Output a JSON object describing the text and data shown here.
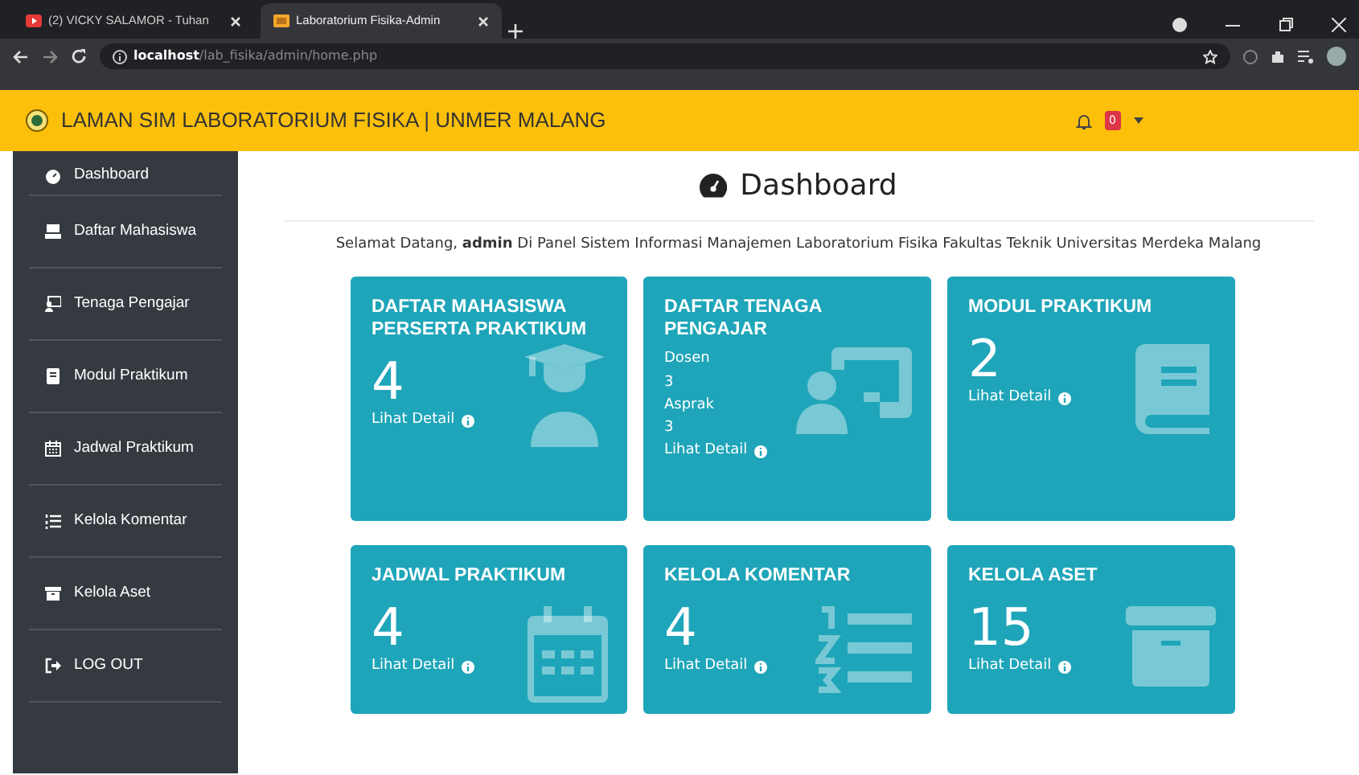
{
  "browser": {
    "tabs": [
      {
        "title": "(2) VICKY SALAMOR - Tuhan",
        "selected": false
      },
      {
        "title": "Laboratorium Fisika-Admin",
        "selected": true
      }
    ],
    "address": {
      "host": "localhost",
      "path": "/lab_fisika/admin/home.php"
    }
  },
  "navbar": {
    "title": "LAMAN SIM LABORATORIUM FISIKA | UNMER MALANG",
    "badge": "0"
  },
  "sidebar": {
    "items": [
      {
        "label": "Dashboard"
      },
      {
        "label": "Daftar Mahasiswa"
      },
      {
        "label": "Tenaga Pengajar"
      },
      {
        "label": "Modul Praktikum"
      },
      {
        "label": "Jadwal Praktikum"
      },
      {
        "label": "Kelola Komentar"
      },
      {
        "label": "Kelola Aset"
      },
      {
        "label": "LOG OUT"
      }
    ]
  },
  "main": {
    "heading": "Dashboard",
    "welcome": "Selamat Datang, **admin** Di Panel Sistem Informasi Manajemen Laboratorium Fisika Fakultas Teknik Universitas Merdeka Malang",
    "cards": [
      {
        "kind": "count",
        "title": "DAFTAR MAHASISWA PERSERTA PRAKTIKUM",
        "value": "4",
        "link": "Lihat Detail"
      },
      {
        "kind": "breakdown",
        "title": "DAFTAR TENAGA PENGAJAR",
        "lines": [
          {
            "label": "Dosen",
            "value": "3"
          },
          {
            "label": "Asprak",
            "value": "3"
          }
        ],
        "link": "Lihat Detail"
      },
      {
        "kind": "count",
        "title": "MODUL PRAKTIKUM",
        "value": "2",
        "link": "Lihat Detail"
      },
      {
        "kind": "count",
        "title": "JADWAL PRAKTIKUM",
        "value": "4",
        "link": "Lihat Detail"
      },
      {
        "kind": "count",
        "title": "KELOLA KOMENTAR",
        "value": "4",
        "link": "Lihat Detail"
      },
      {
        "kind": "count",
        "title": "KELOLA ASET",
        "value": "15",
        "link": "Lihat Detail"
      }
    ]
  }
}
